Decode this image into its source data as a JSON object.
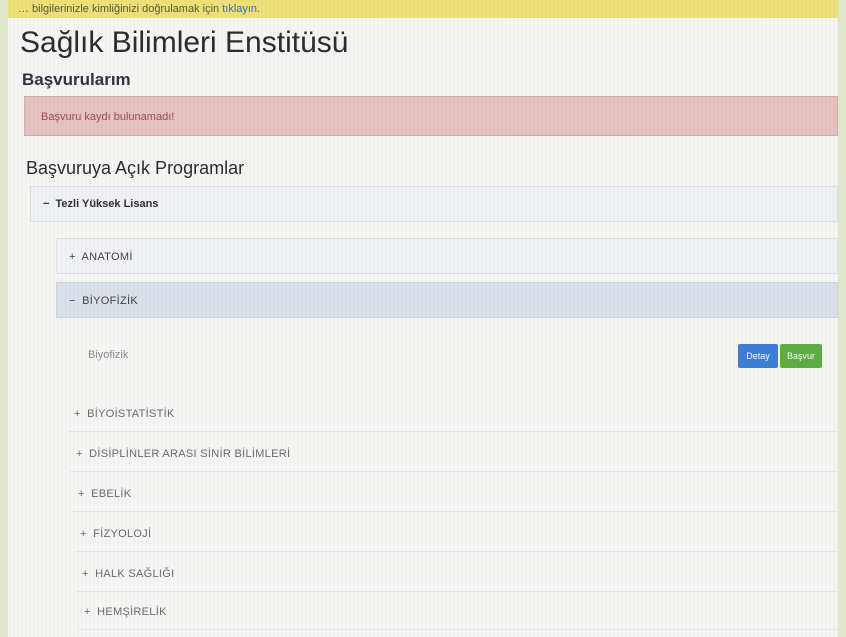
{
  "banner": {
    "text": "… bilgilerinizle kimliğinizi doğrulamak için",
    "link_text": "tıklayın."
  },
  "page": {
    "title": "Sağlık Bilimleri Enstitüsü",
    "applications_title": "Başvurularım",
    "no_record_alert": "Başvuru kaydı bulunamadı!",
    "open_programs_title": "Başvuruya Açık Programlar"
  },
  "program_group": {
    "toggle": "−",
    "label": "Tezli Yüksek Lisans"
  },
  "programs": [
    {
      "toggle": "+",
      "label": "ANATOMİ"
    },
    {
      "toggle": "−",
      "label": "BİYOFİZİK"
    },
    {
      "toggle": "+",
      "label": "BİYOİSTATİSTİK"
    },
    {
      "toggle": "+",
      "label": "DİSİPLİNLER ARASI SİNİR BİLİMLERİ"
    },
    {
      "toggle": "+",
      "label": "EBELİK"
    },
    {
      "toggle": "+",
      "label": "FİZYOLOJİ"
    },
    {
      "toggle": "+",
      "label": "HALK SAĞLIĞI"
    },
    {
      "toggle": "+",
      "label": "HEMŞİRELİK"
    }
  ],
  "expanded_program": {
    "label": "Biyofizik",
    "detail_button": "Detay",
    "apply_button": "Başvur"
  },
  "colors": {
    "banner": "#f0e37a",
    "alert_bg": "#e7c3c5",
    "detail_button": "#3f7fd8",
    "apply_button": "#5fae45"
  }
}
